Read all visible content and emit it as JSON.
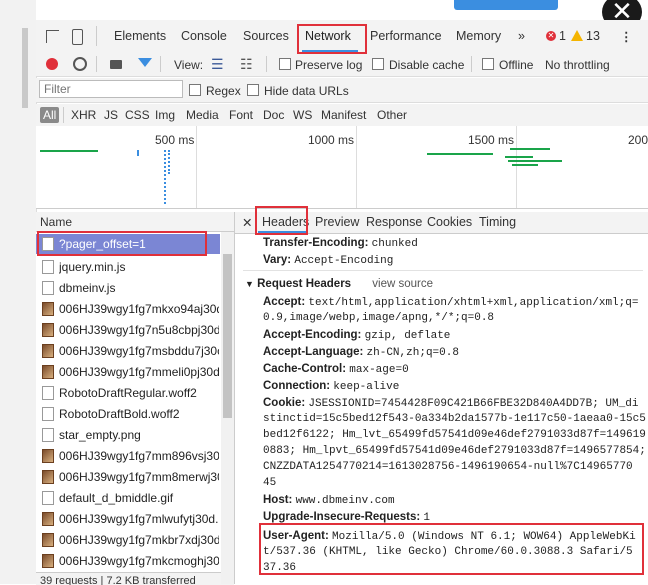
{
  "tabs": {
    "elements": "Elements",
    "console": "Console",
    "sources": "Sources",
    "network": "Network",
    "performance": "Performance",
    "memory": "Memory",
    "more": "»",
    "errors": "1",
    "warnings": "13"
  },
  "toolbar": {
    "view_label": "View:",
    "preserve_log": "Preserve log",
    "disable_cache": "Disable cache",
    "offline": "Offline",
    "throttling": "No throttling"
  },
  "filter": {
    "placeholder": "Filter",
    "regex": "Regex",
    "hide_data_urls": "Hide data URLs"
  },
  "types": [
    "All",
    "XHR",
    "JS",
    "CSS",
    "Img",
    "Media",
    "Font",
    "Doc",
    "WS",
    "Manifest",
    "Other"
  ],
  "timeline": {
    "ticks": [
      "500 ms",
      "1000 ms",
      "1500 ms",
      "200"
    ]
  },
  "list": {
    "name_header": "Name",
    "rows": [
      "?pager_offset=1",
      "jquery.min.js",
      "dbmeinv.js",
      "006HJ39wgy1fg7mkxo94aj30d",
      "006HJ39wgy1fg7n5u8cbpj30d",
      "006HJ39wgy1fg7msbddu7j30c",
      "006HJ39wgy1fg7mmeli0pj30d",
      "RobotoDraftRegular.woff2",
      "RobotoDraftBold.woff2",
      "star_empty.png",
      "006HJ39wgy1fg7mm896vsj30.",
      "006HJ39wgy1fg7mm8merwj30",
      "default_d_bmiddle.gif",
      "006HJ39wgy1fg7mlwufytj30d.",
      "006HJ39wgy1fg7mkbr7xdj30d",
      "006HJ39wgy1fg7mkcmoghj30"
    ],
    "status": "39 requests | 7.2 KB transferred"
  },
  "details": {
    "tabs": [
      "Headers",
      "Preview",
      "Response",
      "Cookies",
      "Timing"
    ],
    "response_headers": [
      {
        "k": "Transfer-Encoding:",
        "v": "chunked"
      },
      {
        "k": "Vary:",
        "v": "Accept-Encoding"
      }
    ],
    "request_headers_title": "Request Headers",
    "view_source": "view source",
    "accept_k": "Accept:",
    "accept_v1": "text/html,application/xhtml+xml,application/xml;q=",
    "accept_v2": "0.9,image/webp,image/apng,*/*;q=0.8",
    "accept_encoding_k": "Accept-Encoding:",
    "accept_encoding_v": "gzip, deflate",
    "accept_language_k": "Accept-Language:",
    "accept_language_v": "zh-CN,zh;q=0.8",
    "cache_control_k": "Cache-Control:",
    "cache_control_v": "max-age=0",
    "connection_k": "Connection:",
    "connection_v": "keep-alive",
    "cookie_k": "Cookie:",
    "cookie_lines": [
      "JSESSIONID=7454428F09C421B66FBE32D840A4DD7B; UM_di",
      "stinctid=15c5bed12f543-0a334b2da1577b-1e117c50-1aeaa0-15c5",
      "bed12f6122; Hm_lvt_65499fd57541d09e46def2791033d87f=149619",
      "0883; Hm_lpvt_65499fd57541d09e46def2791033d87f=1496577854;",
      "CNZZDATA1254770214=1613028756-1496190654-null%7C14965770",
      "45"
    ],
    "host_k": "Host:",
    "host_v": "www.dbmeinv.com",
    "upgrade_k": "Upgrade-Insecure-Requests:",
    "upgrade_v": "1",
    "ua_k": "User-Agent:",
    "ua_lines": [
      "Mozilla/5.0 (Windows NT 6.1; WOW64) AppleWebKi",
      "t/537.36 (KHTML, like Gecko) Chrome/60.0.3088.3 Safari/5",
      "37.36"
    ]
  },
  "colors": {
    "network_accent": "#e0303a",
    "selected_row": "#7b86d4",
    "bar_green": "#1aa44a"
  }
}
